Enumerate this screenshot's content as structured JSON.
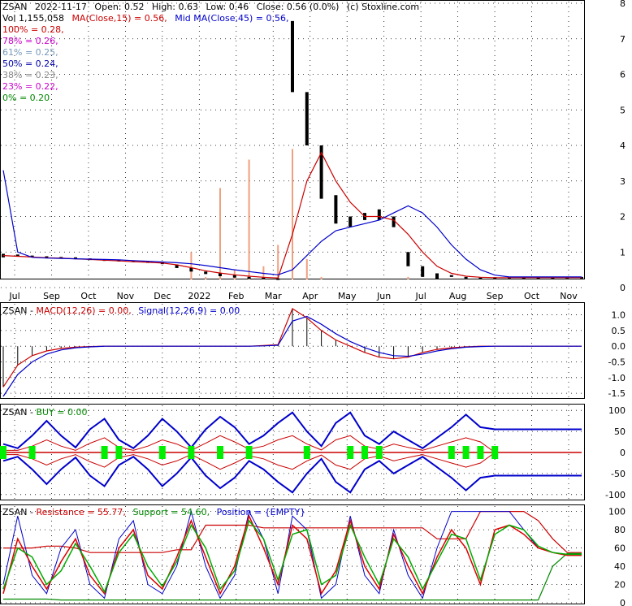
{
  "chart_data": [
    {
      "type": "candlestick",
      "panel": "price",
      "header": {
        "ticker": "ZSAN",
        "date": "2022-11-17",
        "open": "Open: 0.52",
        "high": "High: 0.63",
        "low": "Low: 0.46",
        "close": "Close: 0.56 (0.0%)",
        "source": "(c) Stoxline.com",
        "volume": "Vol 1,155,058",
        "ma_short": "MA(Close,15) = 0.56,",
        "ma_mid": "Mid MA(Close,45) = 0.56,"
      },
      "fib_levels": [
        {
          "label": "100% = 0.28,",
          "color": "#cc0000"
        },
        {
          "label": "78% = 0.26,",
          "color": "#cc00cc"
        },
        {
          "label": "61% = 0.25,",
          "color": "#7799bb"
        },
        {
          "label": "50% = 0.24,",
          "color": "#0000aa"
        },
        {
          "label": "38% = 0.23,",
          "color": "#888888"
        },
        {
          "label": "23% = 0.22,",
          "color": "#cc00cc"
        },
        {
          "label": "0% = 0.20",
          "color": "#008800"
        }
      ],
      "months": [
        "Jul",
        "Sep",
        "Oct",
        "Nov",
        "Dec",
        "2022",
        "Feb",
        "Mar",
        "Apr",
        "May",
        "Jun",
        "Jul",
        "Aug",
        "Sep",
        "Oct",
        "Nov"
      ],
      "yticks": [
        "0",
        "1",
        "2",
        "3",
        "4",
        "5",
        "6",
        "7",
        "8"
      ],
      "ylim": [
        0,
        8
      ],
      "price_series": [
        [
          0.95,
          0.85
        ],
        [
          0.93,
          0.88
        ],
        [
          0.9,
          0.86
        ],
        [
          0.88,
          0.84
        ],
        [
          0.86,
          0.82
        ],
        [
          0.85,
          0.8
        ],
        [
          0.82,
          0.78
        ],
        [
          0.8,
          0.75
        ],
        [
          0.78,
          0.74
        ],
        [
          0.76,
          0.72
        ],
        [
          0.74,
          0.7
        ],
        [
          0.72,
          0.66
        ],
        [
          0.65,
          0.55
        ],
        [
          0.55,
          0.45
        ],
        [
          0.45,
          0.38
        ],
        [
          0.4,
          0.32
        ],
        [
          0.35,
          0.28
        ],
        [
          0.3,
          0.25
        ],
        [
          0.28,
          0.24
        ],
        [
          0.26,
          0.24
        ],
        [
          7.5,
          5.5
        ],
        [
          5.5,
          4.0
        ],
        [
          4.0,
          2.5
        ],
        [
          2.6,
          1.8
        ],
        [
          2.0,
          1.7
        ],
        [
          2.1,
          1.9
        ],
        [
          2.2,
          1.9
        ],
        [
          2.0,
          1.7
        ],
        [
          1.0,
          0.6
        ],
        [
          0.6,
          0.3
        ],
        [
          0.4,
          0.25
        ],
        [
          0.35,
          0.3
        ],
        [
          0.3,
          0.26
        ],
        [
          0.28,
          0.25
        ],
        [
          0.29,
          0.25
        ],
        [
          0.3,
          0.26
        ],
        [
          0.29,
          0.25
        ],
        [
          0.28,
          0.25
        ],
        [
          0.29,
          0.26
        ],
        [
          0.3,
          0.27
        ],
        [
          0.3,
          0.27
        ]
      ],
      "ma_short_series": [
        0.9,
        0.88,
        0.86,
        0.84,
        0.83,
        0.81,
        0.79,
        0.77,
        0.75,
        0.73,
        0.71,
        0.69,
        0.64,
        0.56,
        0.47,
        0.41,
        0.36,
        0.32,
        0.29,
        0.27,
        1.5,
        3.0,
        3.8,
        3.0,
        2.4,
        2.0,
        2.0,
        1.9,
        1.5,
        1.0,
        0.6,
        0.4,
        0.32,
        0.29,
        0.28,
        0.28,
        0.28,
        0.28,
        0.28,
        0.28,
        0.28
      ],
      "ma_mid_series": [
        3.3,
        1.0,
        0.85,
        0.83,
        0.82,
        0.81,
        0.8,
        0.79,
        0.78,
        0.76,
        0.74,
        0.72,
        0.7,
        0.67,
        0.62,
        0.56,
        0.5,
        0.45,
        0.4,
        0.36,
        0.5,
        0.9,
        1.3,
        1.6,
        1.7,
        1.8,
        1.9,
        2.1,
        2.3,
        2.1,
        1.7,
        1.2,
        0.8,
        0.5,
        0.35,
        0.3,
        0.3,
        0.3,
        0.3,
        0.3,
        0.3
      ],
      "volume_series": [
        0.1,
        0.2,
        0.1,
        0.1,
        0.1,
        0.15,
        0.2,
        0.1,
        0.1,
        0.15,
        0.1,
        0.1,
        0.2,
        1.0,
        0.3,
        2.8,
        0.5,
        3.6,
        0.6,
        1.2,
        3.9,
        0.8,
        0.3,
        0.2,
        0.2,
        0.1,
        0.15,
        0.1,
        0.3,
        0.2,
        0.1,
        0.1,
        0.1,
        0.1,
        0.1,
        0.1,
        0.1,
        0.1,
        0.1,
        0.1,
        0.1
      ]
    },
    {
      "type": "line",
      "panel": "macd",
      "title_ticker": "ZSAN - ",
      "title_macd": "MACD(12,26) = 0.00,",
      "title_signal": "Signal(12,26,9) = 0.00",
      "yticks": [
        "1.0",
        "0.5",
        "0.0",
        "-0.5",
        "-1.0",
        "-1.5"
      ],
      "ylim": [
        -1.6,
        1.3
      ],
      "macd_series": [
        -1.3,
        -0.6,
        -0.3,
        -0.15,
        -0.07,
        -0.03,
        -0.01,
        0,
        0,
        0,
        0,
        0,
        0,
        0,
        0,
        0,
        0,
        0,
        0.02,
        0.05,
        1.2,
        0.9,
        0.5,
        0.2,
        0,
        -0.2,
        -0.35,
        -0.4,
        -0.35,
        -0.2,
        -0.1,
        -0.05,
        -0.02,
        0,
        0,
        0,
        0,
        0,
        0,
        0,
        0
      ],
      "signal_series": [
        -1.6,
        -0.9,
        -0.5,
        -0.25,
        -0.12,
        -0.05,
        -0.02,
        0,
        0,
        0,
        0,
        0,
        0,
        0,
        0,
        0,
        0,
        0,
        0.01,
        0.03,
        0.8,
        0.95,
        0.7,
        0.4,
        0.15,
        -0.05,
        -0.2,
        -0.3,
        -0.32,
        -0.25,
        -0.15,
        -0.08,
        -0.03,
        -0.01,
        0,
        0,
        0,
        0,
        0,
        0,
        0
      ]
    },
    {
      "type": "line",
      "panel": "buy",
      "title_ticker": "ZSAN - ",
      "title_buy": "BUY = 0.00",
      "yticks": [
        "100",
        "50",
        "0",
        "-50",
        "-100"
      ],
      "ylim": [
        -110,
        110
      ],
      "upper_band": [
        20,
        10,
        40,
        75,
        40,
        12,
        55,
        80,
        30,
        10,
        40,
        80,
        50,
        12,
        55,
        85,
        60,
        20,
        40,
        70,
        95,
        50,
        15,
        70,
        95,
        40,
        20,
        50,
        30,
        10,
        35,
        60,
        90,
        60,
        55,
        55,
        55,
        55,
        55,
        55,
        55
      ],
      "lower_band": [
        -20,
        -10,
        -40,
        -75,
        -40,
        -12,
        -55,
        -80,
        -30,
        -10,
        -40,
        -80,
        -50,
        -12,
        -55,
        -85,
        -60,
        -20,
        -40,
        -70,
        -95,
        -50,
        -15,
        -70,
        -95,
        -40,
        -20,
        -50,
        -30,
        -10,
        -35,
        -60,
        -90,
        -60,
        -55,
        -55,
        -55,
        -55,
        -55,
        -55,
        -55
      ],
      "inner_upper": [
        5,
        5,
        15,
        30,
        15,
        5,
        22,
        35,
        12,
        5,
        15,
        30,
        20,
        5,
        22,
        40,
        25,
        8,
        15,
        30,
        40,
        20,
        6,
        30,
        40,
        15,
        8,
        20,
        12,
        5,
        15,
        25,
        35,
        25,
        0,
        0,
        0,
        0,
        0,
        0,
        0
      ],
      "buy_markers": [
        0,
        2,
        7,
        8,
        11,
        13,
        15,
        17,
        21,
        24,
        25,
        26,
        31,
        32,
        33,
        34
      ]
    },
    {
      "type": "line",
      "panel": "position",
      "title_ticker": "ZSAN - ",
      "title_resistance": "Resistance = 55.77,",
      "title_support": "Support = 54.60,",
      "title_position": "Position = {EMPTY}",
      "yticks": [
        "100",
        "80",
        "60",
        "40",
        "20",
        "0"
      ],
      "ylim": [
        0,
        105
      ],
      "resistance_series": [
        60,
        60,
        60,
        62,
        62,
        60,
        55,
        55,
        55,
        55,
        55,
        55,
        58,
        58,
        85,
        85,
        85,
        85,
        82,
        82,
        82,
        82,
        82,
        82,
        82,
        82,
        82,
        82,
        82,
        82,
        70,
        70,
        70,
        100,
        100,
        100,
        100,
        90,
        70,
        55,
        55
      ],
      "support_series": [
        4,
        4,
        4,
        4,
        3,
        3,
        3,
        3,
        3,
        3,
        3,
        3,
        3,
        3,
        3,
        3,
        3,
        3,
        3,
        3,
        3,
        3,
        3,
        3,
        3,
        3,
        3,
        3,
        3,
        3,
        3,
        3,
        3,
        3,
        3,
        3,
        3,
        3,
        40,
        54,
        54
      ],
      "k_series": [
        10,
        70,
        40,
        15,
        45,
        70,
        30,
        10,
        60,
        80,
        30,
        15,
        50,
        90,
        50,
        10,
        40,
        95,
        60,
        20,
        85,
        70,
        10,
        35,
        90,
        40,
        15,
        75,
        40,
        10,
        50,
        80,
        60,
        20,
        80,
        85,
        75,
        60,
        55,
        52,
        52
      ],
      "d_series": [
        15,
        60,
        50,
        20,
        35,
        65,
        40,
        12,
        55,
        75,
        40,
        18,
        45,
        85,
        60,
        15,
        35,
        90,
        70,
        25,
        75,
        80,
        20,
        30,
        85,
        50,
        20,
        70,
        50,
        15,
        45,
        75,
        70,
        25,
        75,
        85,
        80,
        62,
        55,
        53,
        53
      ],
      "position_series": [
        20,
        95,
        30,
        10,
        60,
        80,
        20,
        5,
        70,
        90,
        20,
        10,
        40,
        100,
        40,
        5,
        30,
        100,
        70,
        10,
        95,
        80,
        5,
        20,
        95,
        30,
        10,
        80,
        30,
        5,
        60,
        100,
        100,
        100,
        100,
        100,
        80,
        60,
        55,
        52,
        52
      ]
    }
  ]
}
